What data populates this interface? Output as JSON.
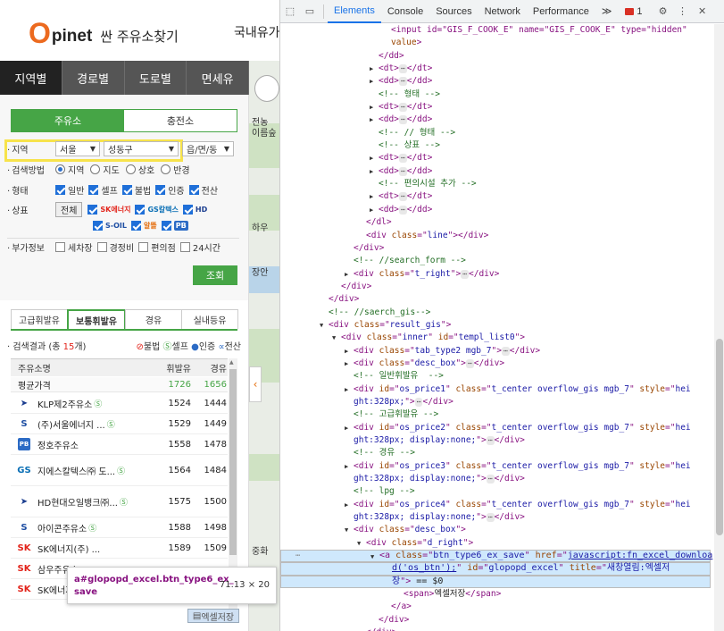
{
  "site": {
    "logo_o": "O",
    "logo_rest": "pinet",
    "logo_sub": "싼 주유소찾기",
    "top_right": "국내유가",
    "main_tabs": [
      "지역별",
      "경로별",
      "도로별",
      "면세유"
    ],
    "sub_tabs": [
      "주유소",
      "충전소"
    ],
    "region_label": "지역",
    "region_values": [
      "서울",
      "성동구",
      "읍/면/동"
    ],
    "method_label": "검색방법",
    "methods": [
      "지역",
      "지도",
      "상호",
      "반경"
    ],
    "type_label": "형태",
    "types": [
      "일반",
      "셀프",
      "불법",
      "인증",
      "전산"
    ],
    "brand_label": "상표",
    "brand_all": "전체",
    "brands": [
      "SK에너지",
      "GS칼텍스",
      "HD",
      "S-OIL",
      "알뜰",
      "PB"
    ],
    "extra_label": "부가정보",
    "extras": [
      "세차장",
      "경정비",
      "편의점",
      "24시간"
    ],
    "search_button": "조회",
    "fuel_tabs": [
      "고급휘발유",
      "보통휘발유",
      "경유",
      "실내등유"
    ],
    "count_text_prefix": "검색결과 (총 ",
    "count_num": "15",
    "count_text_suffix": "개)",
    "legend": [
      "불법",
      "셀프",
      "인증",
      "전산"
    ],
    "table_headers": [
      "주유소명",
      "휘발유",
      "경유"
    ],
    "avg": {
      "name": "평균가격",
      "gasoline": "1726",
      "diesel": "1656"
    },
    "stations": [
      {
        "name": "KLP제2주유소",
        "self": "Ⓢ",
        "brand": "hd",
        "gasoline": "1524",
        "diesel": "1444"
      },
      {
        "name": "(주)서울에너지 ...",
        "self": "Ⓢ",
        "brand": "soil",
        "gasoline": "1529",
        "diesel": "1449"
      },
      {
        "name": "정호주유소",
        "self": "",
        "brand": "pb",
        "gasoline": "1558",
        "diesel": "1478"
      },
      {
        "name": "지에스칼텍스㈜ 도...",
        "self": "Ⓢ",
        "brand": "gs",
        "gasoline": "1564",
        "diesel": "1484"
      },
      {
        "name": "HD현대오일뱅크㈜...",
        "self": "Ⓢ",
        "brand": "hd",
        "gasoline": "1575",
        "diesel": "1500"
      },
      {
        "name": "아이콘주유소",
        "self": "Ⓢ",
        "brand": "soil",
        "gasoline": "1588",
        "diesel": "1498"
      },
      {
        "name": "SK에너지(주) ...",
        "self": "",
        "brand": "sk",
        "gasoline": "1589",
        "diesel": "1509"
      },
      {
        "name": "삼우주유소",
        "self": "",
        "brand": "sk",
        "gasoline": "",
        "diesel": ""
      },
      {
        "name": "SK에너지",
        "self": "",
        "brand": "sk",
        "gasoline": "",
        "diesel": ""
      }
    ],
    "tooltip_selector": "a#glopopd_excel.btn_type6_ex_save",
    "tooltip_dims": "71.13 × 20",
    "excel_button": "엑셀저장",
    "map_labels": [
      "전농",
      "이름숲",
      "하우",
      "장안",
      "중화"
    ]
  },
  "devtools": {
    "toolbar_tabs": [
      "Elements",
      "Console",
      "Sources",
      "Network",
      "Performance"
    ],
    "more": "≫",
    "error_count": "1",
    "lines": [
      {
        "indent": 8,
        "tw": "",
        "parts": [
          [
            "t",
            "<input id=\"GIS_F_COOK_E\" name=\"GIS_F_COOK_E\" type=\"hidden\""
          ]
        ]
      },
      {
        "indent": 8,
        "tw": "",
        "parts": [
          [
            "a",
            "value"
          ],
          [
            "t",
            ">"
          ]
        ]
      },
      {
        "indent": 7,
        "tw": "",
        "parts": [
          [
            "t",
            "</dd>"
          ]
        ]
      },
      {
        "indent": 7,
        "tw": "▶",
        "parts": [
          [
            "t",
            "<dt>"
          ],
          [
            "d",
            "⋯"
          ],
          [
            "t",
            "</dt>"
          ]
        ]
      },
      {
        "indent": 7,
        "tw": "▶",
        "parts": [
          [
            "t",
            "<dd>"
          ],
          [
            "d",
            "⋯"
          ],
          [
            "t",
            "</dd>"
          ]
        ]
      },
      {
        "indent": 7,
        "tw": "",
        "parts": [
          [
            "c",
            "<!-- 형태 -->"
          ]
        ]
      },
      {
        "indent": 7,
        "tw": "▶",
        "parts": [
          [
            "t",
            "<dt>"
          ],
          [
            "d",
            "⋯"
          ],
          [
            "t",
            "</dt>"
          ]
        ]
      },
      {
        "indent": 7,
        "tw": "▶",
        "parts": [
          [
            "t",
            "<dd>"
          ],
          [
            "d",
            "⋯"
          ],
          [
            "t",
            "</dd>"
          ]
        ]
      },
      {
        "indent": 7,
        "tw": "",
        "parts": [
          [
            "c",
            "<!-- // 형태 -->"
          ]
        ]
      },
      {
        "indent": 7,
        "tw": "",
        "parts": [
          [
            "c",
            "<!-- 상표 -->"
          ]
        ]
      },
      {
        "indent": 7,
        "tw": "▶",
        "parts": [
          [
            "t",
            "<dt>"
          ],
          [
            "d",
            "⋯"
          ],
          [
            "t",
            "</dt>"
          ]
        ]
      },
      {
        "indent": 7,
        "tw": "▶",
        "parts": [
          [
            "t",
            "<dd>"
          ],
          [
            "d",
            "⋯"
          ],
          [
            "t",
            "</dd>"
          ]
        ]
      },
      {
        "indent": 7,
        "tw": "",
        "parts": [
          [
            "c",
            "<!-- 편의시설 추가 -->"
          ]
        ]
      },
      {
        "indent": 7,
        "tw": "▶",
        "parts": [
          [
            "t",
            "<dt>"
          ],
          [
            "d",
            "⋯"
          ],
          [
            "t",
            "</dt>"
          ]
        ]
      },
      {
        "indent": 7,
        "tw": "▶",
        "parts": [
          [
            "t",
            "<dd>"
          ],
          [
            "d",
            "⋯"
          ],
          [
            "t",
            "</dd>"
          ]
        ]
      },
      {
        "indent": 6,
        "tw": "",
        "parts": [
          [
            "t",
            "</dl>"
          ]
        ]
      },
      {
        "indent": 6,
        "tw": "",
        "parts": [
          [
            "t",
            "<div "
          ],
          [
            "a",
            "class"
          ],
          [
            "t",
            "=\""
          ],
          [
            "v",
            "line"
          ],
          [
            "t",
            "\"></div>"
          ]
        ]
      },
      {
        "indent": 5,
        "tw": "",
        "parts": [
          [
            "t",
            "</div>"
          ]
        ]
      },
      {
        "indent": 5,
        "tw": "",
        "parts": [
          [
            "c",
            "<!-- //search_form -->"
          ]
        ]
      },
      {
        "indent": 5,
        "tw": "▶",
        "parts": [
          [
            "t",
            "<div "
          ],
          [
            "a",
            "class"
          ],
          [
            "t",
            "=\""
          ],
          [
            "v",
            "t_right"
          ],
          [
            "t",
            "\">"
          ],
          [
            "d",
            "⋯"
          ],
          [
            "t",
            "</div>"
          ]
        ]
      },
      {
        "indent": 4,
        "tw": "",
        "parts": [
          [
            "t",
            "</div>"
          ]
        ]
      },
      {
        "indent": 3,
        "tw": "",
        "parts": [
          [
            "t",
            "</div>"
          ]
        ]
      },
      {
        "indent": 3,
        "tw": "",
        "parts": [
          [
            "c",
            "<!-- //saerch_gis-->"
          ]
        ]
      },
      {
        "indent": 3,
        "tw": "▼",
        "parts": [
          [
            "t",
            "<div "
          ],
          [
            "a",
            "class"
          ],
          [
            "t",
            "=\""
          ],
          [
            "v",
            "result_gis"
          ],
          [
            "t",
            "\">"
          ]
        ]
      },
      {
        "indent": 4,
        "tw": "▼",
        "parts": [
          [
            "t",
            "<div "
          ],
          [
            "a",
            "class"
          ],
          [
            "t",
            "=\""
          ],
          [
            "v",
            "inner"
          ],
          [
            "t",
            "\" "
          ],
          [
            "a",
            "id"
          ],
          [
            "t",
            "=\""
          ],
          [
            "v",
            "templ_list0"
          ],
          [
            "t",
            "\">"
          ]
        ]
      },
      {
        "indent": 5,
        "tw": "▶",
        "parts": [
          [
            "t",
            "<div "
          ],
          [
            "a",
            "class"
          ],
          [
            "t",
            "=\""
          ],
          [
            "v",
            "tab_type2 mgb_7"
          ],
          [
            "t",
            "\">"
          ],
          [
            "d",
            "⋯"
          ],
          [
            "t",
            "</div>"
          ]
        ]
      },
      {
        "indent": 5,
        "tw": "▶",
        "parts": [
          [
            "t",
            "<div "
          ],
          [
            "a",
            "class"
          ],
          [
            "t",
            "=\""
          ],
          [
            "v",
            "desc_box"
          ],
          [
            "t",
            "\">"
          ],
          [
            "d",
            "⋯"
          ],
          [
            "t",
            "</div>"
          ]
        ]
      },
      {
        "indent": 5,
        "tw": "",
        "parts": [
          [
            "c",
            "<!-- 일반휘발유  -->"
          ]
        ]
      },
      {
        "indent": 5,
        "tw": "▶",
        "parts": [
          [
            "t",
            "<div "
          ],
          [
            "a",
            "id"
          ],
          [
            "t",
            "=\""
          ],
          [
            "v",
            "os_price1"
          ],
          [
            "t",
            "\" "
          ],
          [
            "a",
            "class"
          ],
          [
            "t",
            "=\""
          ],
          [
            "v",
            "t_center overflow_gis mgb_7"
          ],
          [
            "t",
            "\" "
          ],
          [
            "a",
            "style"
          ],
          [
            "t",
            "=\""
          ],
          [
            "v",
            "hei"
          ]
        ]
      },
      {
        "indent": 5,
        "tw": "",
        "parts": [
          [
            "v",
            "ght:328px;"
          ],
          [
            "t",
            "\">"
          ],
          [
            "d",
            "⋯"
          ],
          [
            "t",
            "</div>"
          ]
        ]
      },
      {
        "indent": 5,
        "tw": "",
        "parts": [
          [
            "c",
            "<!-- 고급휘발유 -->"
          ]
        ]
      },
      {
        "indent": 5,
        "tw": "▶",
        "parts": [
          [
            "t",
            "<div "
          ],
          [
            "a",
            "id"
          ],
          [
            "t",
            "=\""
          ],
          [
            "v",
            "os_price2"
          ],
          [
            "t",
            "\" "
          ],
          [
            "a",
            "class"
          ],
          [
            "t",
            "=\""
          ],
          [
            "v",
            "t_center overflow_gis mgb_7"
          ],
          [
            "t",
            "\" "
          ],
          [
            "a",
            "style"
          ],
          [
            "t",
            "=\""
          ],
          [
            "v",
            "hei"
          ]
        ]
      },
      {
        "indent": 5,
        "tw": "",
        "parts": [
          [
            "v",
            "ght:328px; display:none;"
          ],
          [
            "t",
            "\">"
          ],
          [
            "d",
            "⋯"
          ],
          [
            "t",
            "</div>"
          ]
        ]
      },
      {
        "indent": 5,
        "tw": "",
        "parts": [
          [
            "c",
            "<!-- 경유 -->"
          ]
        ]
      },
      {
        "indent": 5,
        "tw": "▶",
        "parts": [
          [
            "t",
            "<div "
          ],
          [
            "a",
            "id"
          ],
          [
            "t",
            "=\""
          ],
          [
            "v",
            "os_price3"
          ],
          [
            "t",
            "\" "
          ],
          [
            "a",
            "class"
          ],
          [
            "t",
            "=\""
          ],
          [
            "v",
            "t_center overflow_gis mgb_7"
          ],
          [
            "t",
            "\" "
          ],
          [
            "a",
            "style"
          ],
          [
            "t",
            "=\""
          ],
          [
            "v",
            "hei"
          ]
        ]
      },
      {
        "indent": 5,
        "tw": "",
        "parts": [
          [
            "v",
            "ght:328px; display:none;"
          ],
          [
            "t",
            "\">"
          ],
          [
            "d",
            "⋯"
          ],
          [
            "t",
            "</div>"
          ]
        ]
      },
      {
        "indent": 5,
        "tw": "",
        "parts": [
          [
            "c",
            "<!-- lpg -->"
          ]
        ]
      },
      {
        "indent": 5,
        "tw": "▶",
        "parts": [
          [
            "t",
            "<div "
          ],
          [
            "a",
            "id"
          ],
          [
            "t",
            "=\""
          ],
          [
            "v",
            "os_price4"
          ],
          [
            "t",
            "\" "
          ],
          [
            "a",
            "class"
          ],
          [
            "t",
            "=\""
          ],
          [
            "v",
            "t_center overflow_gis mgb_7"
          ],
          [
            "t",
            "\" "
          ],
          [
            "a",
            "style"
          ],
          [
            "t",
            "=\""
          ],
          [
            "v",
            "hei"
          ]
        ]
      },
      {
        "indent": 5,
        "tw": "",
        "parts": [
          [
            "v",
            "ght:328px; display:none;"
          ],
          [
            "t",
            "\">"
          ],
          [
            "d",
            "⋯"
          ],
          [
            "t",
            "</div>"
          ]
        ]
      },
      {
        "indent": 5,
        "tw": "▼",
        "parts": [
          [
            "t",
            "<div "
          ],
          [
            "a",
            "class"
          ],
          [
            "t",
            "=\""
          ],
          [
            "v",
            "desc_box"
          ],
          [
            "t",
            "\">"
          ]
        ]
      },
      {
        "indent": 6,
        "tw": "▼",
        "parts": [
          [
            "t",
            "<div "
          ],
          [
            "a",
            "class"
          ],
          [
            "t",
            "=\""
          ],
          [
            "v",
            "d_right"
          ],
          [
            "t",
            "\">"
          ]
        ]
      },
      {
        "indent": 7,
        "tw": "▼",
        "sel": true,
        "parts": [
          [
            "t",
            "<a "
          ],
          [
            "a",
            "class"
          ],
          [
            "t",
            "=\""
          ],
          [
            "v",
            "btn_type6_ex_save"
          ],
          [
            "t",
            "\" "
          ],
          [
            "a",
            "href"
          ],
          [
            "t",
            "=\""
          ],
          [
            "l",
            "javascript:fn_excel_downloa"
          ]
        ]
      },
      {
        "indent": 8,
        "tw": "",
        "sel": true,
        "parts": [
          [
            "l",
            "d('os_btn');"
          ],
          [
            "t",
            "\" "
          ],
          [
            "a",
            "id"
          ],
          [
            "t",
            "=\""
          ],
          [
            "v",
            "glopopd_excel"
          ],
          [
            "t",
            "\" "
          ],
          [
            "a",
            "title"
          ],
          [
            "t",
            "=\""
          ],
          [
            "v",
            "새창열림:엑셀저"
          ]
        ]
      },
      {
        "indent": 8,
        "tw": "",
        "sel": true,
        "parts": [
          [
            "v",
            "장"
          ],
          [
            "t",
            "\">"
          ],
          [
            "x",
            " == $0"
          ]
        ]
      },
      {
        "indent": 9,
        "tw": "",
        "parts": [
          [
            "t",
            "<span>"
          ],
          [
            "x",
            "엑셀저장"
          ],
          [
            "t",
            "</span>"
          ]
        ]
      },
      {
        "indent": 8,
        "tw": "",
        "parts": [
          [
            "t",
            "</a>"
          ]
        ]
      },
      {
        "indent": 7,
        "tw": "",
        "parts": [
          [
            "t",
            "</div>"
          ]
        ]
      },
      {
        "indent": 6,
        "tw": "",
        "parts": [
          [
            "t",
            "</div>"
          ]
        ]
      }
    ]
  }
}
